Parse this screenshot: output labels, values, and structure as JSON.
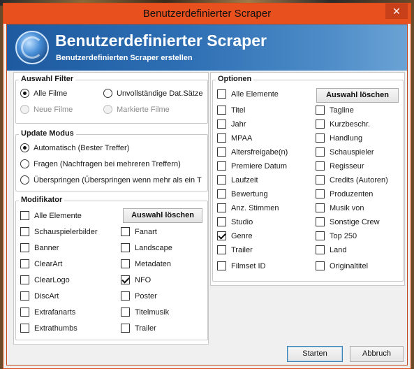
{
  "window": {
    "title": "Benutzerdefinierter Scraper",
    "close_glyph": "✕"
  },
  "banner": {
    "icon": "scraper-globe-icon",
    "heading": "Benutzerdefinierter Scraper",
    "subheading": "Benutzerdefinierten Scraper erstellen"
  },
  "auswahl_filter": {
    "legend": "Auswahl Filter",
    "options": [
      {
        "label": "Alle Filme",
        "checked": true,
        "disabled": false
      },
      {
        "label": "Unvollständige Dat.Sätze",
        "checked": false,
        "disabled": false
      },
      {
        "label": "Neue Filme",
        "checked": false,
        "disabled": true
      },
      {
        "label": "Markierte Filme",
        "checked": false,
        "disabled": true
      }
    ]
  },
  "update_modus": {
    "legend": "Update Modus",
    "options": [
      {
        "label": "Automatisch (Bester Treffer)",
        "checked": true
      },
      {
        "label": "Fragen (Nachfragen bei mehreren Treffern)",
        "checked": false
      },
      {
        "label": "Überspringen (Überspringen wenn mehr als ein T",
        "checked": false
      }
    ]
  },
  "modifikator": {
    "legend": "Modifikator",
    "select_all": {
      "label": "Alle Elemente",
      "checked": false
    },
    "clear_button": "Auswahl löschen",
    "left_items": [
      {
        "label": "Schauspielerbilder",
        "checked": false
      },
      {
        "label": "Banner",
        "checked": false
      },
      {
        "label": "ClearArt",
        "checked": false
      },
      {
        "label": "ClearLogo",
        "checked": false
      },
      {
        "label": "DiscArt",
        "checked": false
      },
      {
        "label": "Extrafanarts",
        "checked": false
      },
      {
        "label": "Extrathumbs",
        "checked": false
      }
    ],
    "right_items": [
      {
        "label": "Fanart",
        "checked": false
      },
      {
        "label": "Landscape",
        "checked": false
      },
      {
        "label": "Metadaten",
        "checked": false
      },
      {
        "label": "NFO",
        "checked": true
      },
      {
        "label": "Poster",
        "checked": false
      },
      {
        "label": "Titelmusik",
        "checked": false
      },
      {
        "label": "Trailer",
        "checked": false
      }
    ]
  },
  "optionen": {
    "legend": "Optionen",
    "select_all": {
      "label": "Alle Elemente",
      "checked": false
    },
    "clear_button": "Auswahl löschen",
    "left_items": [
      {
        "label": "Titel",
        "checked": false
      },
      {
        "label": "Jahr",
        "checked": false
      },
      {
        "label": "MPAA",
        "checked": false
      },
      {
        "label": "Altersfreigabe(n)",
        "checked": false
      },
      {
        "label": "Premiere Datum",
        "checked": false
      },
      {
        "label": "Laufzeit",
        "checked": false
      },
      {
        "label": "Bewertung",
        "checked": false
      },
      {
        "label": "Anz. Stimmen",
        "checked": false
      },
      {
        "label": "Studio",
        "checked": false
      },
      {
        "label": "Genre",
        "checked": true
      },
      {
        "label": "Trailer",
        "checked": false
      },
      {
        "label": "Filmset ID",
        "checked": false
      }
    ],
    "right_items": [
      {
        "label": "Tagline",
        "checked": false
      },
      {
        "label": "Kurzbeschr.",
        "checked": false
      },
      {
        "label": "Handlung",
        "checked": false
      },
      {
        "label": "Schauspieler",
        "checked": false
      },
      {
        "label": "Regisseur",
        "checked": false
      },
      {
        "label": "Credits (Autoren)",
        "checked": false
      },
      {
        "label": "Produzenten",
        "checked": false
      },
      {
        "label": "Musik von",
        "checked": false
      },
      {
        "label": "Sonstige Crew",
        "checked": false
      },
      {
        "label": "Top 250",
        "checked": false
      },
      {
        "label": "Land",
        "checked": false
      },
      {
        "label": "Originaltitel",
        "checked": false
      }
    ]
  },
  "footer": {
    "start_button": "Starten",
    "cancel_button": "Abbruch"
  },
  "colors": {
    "titlebar": "#e8501e",
    "banner_start": "#1e5aa0",
    "banner_end": "#6aa2d4"
  }
}
